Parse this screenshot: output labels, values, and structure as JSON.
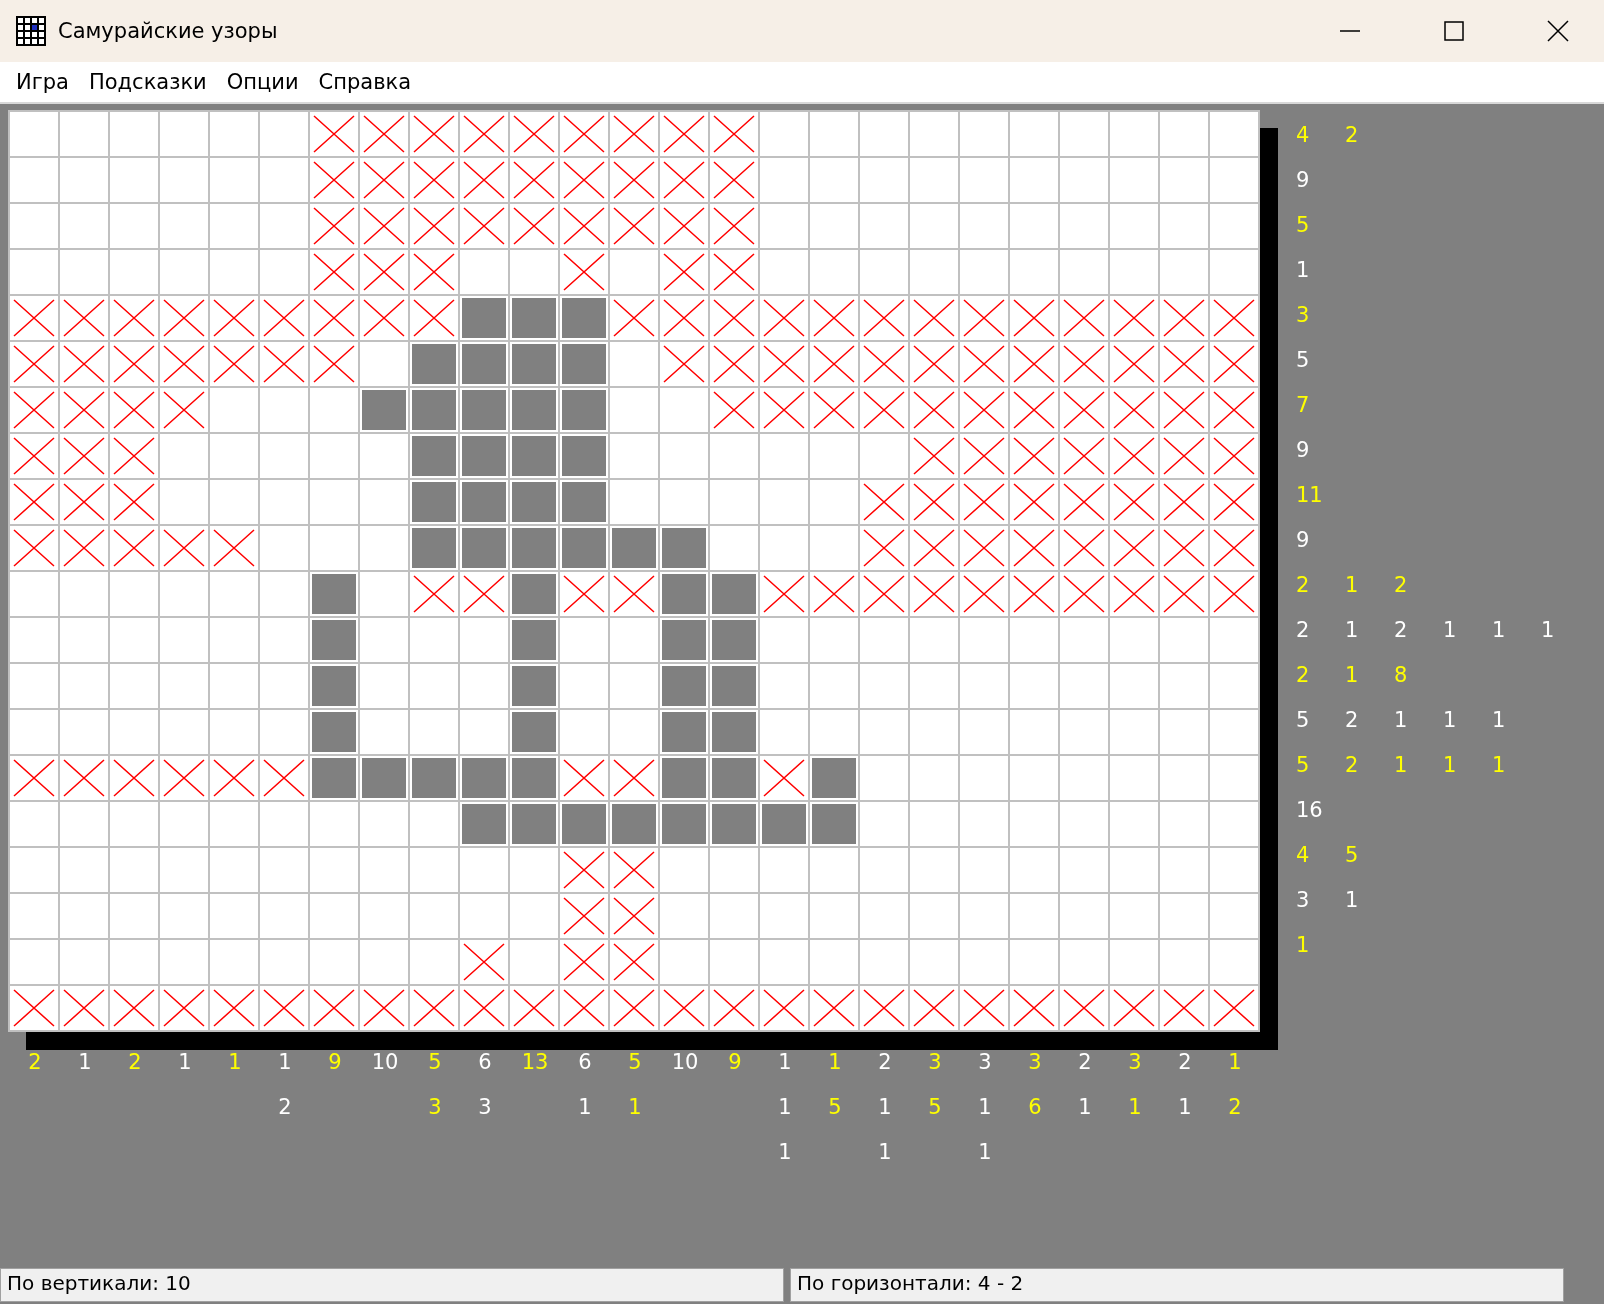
{
  "window": {
    "title": "Самурайские узоры"
  },
  "menu": [
    "Игра",
    "Подсказки",
    "Опции",
    "Справка"
  ],
  "grid": [
    {
      "filled": [
        false,
        false,
        false,
        false,
        false,
        false,
        false,
        false,
        false,
        false,
        false,
        false,
        false,
        false,
        false,
        false,
        false,
        false,
        false,
        false,
        false,
        false,
        false,
        false,
        false
      ],
      "crossed": [
        false,
        false,
        false,
        false,
        false,
        false,
        true,
        true,
        true,
        true,
        true,
        true,
        true,
        true,
        true,
        false,
        false,
        false,
        false,
        false,
        false,
        false,
        false,
        false,
        false
      ]
    },
    {
      "filled": [
        false,
        false,
        false,
        false,
        false,
        false,
        false,
        false,
        false,
        false,
        false,
        false,
        false,
        false,
        false,
        false,
        false,
        false,
        false,
        false,
        false,
        false,
        false,
        false,
        false
      ],
      "crossed": [
        false,
        false,
        false,
        false,
        false,
        false,
        true,
        true,
        true,
        true,
        true,
        true,
        true,
        true,
        true,
        false,
        false,
        false,
        false,
        false,
        false,
        false,
        false,
        false,
        false
      ]
    },
    {
      "filled": [
        false,
        false,
        false,
        false,
        false,
        false,
        false,
        false,
        false,
        false,
        false,
        false,
        false,
        false,
        false,
        false,
        false,
        false,
        false,
        false,
        false,
        false,
        false,
        false,
        false
      ],
      "crossed": [
        false,
        false,
        false,
        false,
        false,
        false,
        true,
        true,
        true,
        true,
        true,
        true,
        true,
        true,
        true,
        false,
        false,
        false,
        false,
        false,
        false,
        false,
        false,
        false,
        false
      ]
    },
    {
      "filled": [
        false,
        false,
        false,
        false,
        false,
        false,
        false,
        false,
        false,
        false,
        false,
        false,
        false,
        false,
        false,
        false,
        false,
        false,
        false,
        false,
        false,
        false,
        false,
        false,
        false
      ],
      "crossed": [
        false,
        false,
        false,
        false,
        false,
        false,
        true,
        true,
        true,
        false,
        false,
        true,
        false,
        true,
        true,
        false,
        false,
        false,
        false,
        false,
        false,
        false,
        false,
        false,
        false
      ]
    },
    {
      "filled": [
        false,
        false,
        false,
        false,
        false,
        false,
        false,
        false,
        false,
        true,
        true,
        true,
        false,
        false,
        false,
        false,
        false,
        false,
        false,
        false,
        false,
        false,
        false,
        false,
        false
      ],
      "crossed": [
        true,
        true,
        true,
        true,
        true,
        true,
        true,
        true,
        true,
        false,
        false,
        false,
        true,
        true,
        true,
        true,
        true,
        true,
        true,
        true,
        true,
        true,
        true,
        true,
        true
      ]
    },
    {
      "filled": [
        false,
        false,
        false,
        false,
        false,
        false,
        false,
        false,
        true,
        true,
        true,
        true,
        false,
        false,
        false,
        false,
        false,
        false,
        false,
        false,
        false,
        false,
        false,
        false,
        false
      ],
      "crossed": [
        true,
        true,
        true,
        true,
        true,
        true,
        true,
        false,
        false,
        false,
        false,
        false,
        false,
        true,
        true,
        true,
        true,
        true,
        true,
        true,
        true,
        true,
        true,
        true,
        true
      ]
    },
    {
      "filled": [
        false,
        false,
        false,
        false,
        false,
        false,
        false,
        true,
        true,
        true,
        true,
        true,
        false,
        false,
        false,
        false,
        false,
        false,
        false,
        false,
        false,
        false,
        false,
        false,
        false
      ],
      "crossed": [
        true,
        true,
        true,
        true,
        false,
        false,
        false,
        false,
        false,
        false,
        false,
        false,
        false,
        false,
        true,
        true,
        true,
        true,
        true,
        true,
        true,
        true,
        true,
        true,
        true
      ]
    },
    {
      "filled": [
        false,
        false,
        false,
        false,
        false,
        false,
        false,
        false,
        true,
        true,
        true,
        true,
        false,
        false,
        false,
        false,
        false,
        false,
        false,
        false,
        false,
        false,
        false,
        false,
        false
      ],
      "crossed": [
        true,
        true,
        true,
        false,
        false,
        false,
        false,
        false,
        false,
        false,
        false,
        false,
        false,
        false,
        false,
        false,
        false,
        false,
        true,
        true,
        true,
        true,
        true,
        true,
        true
      ]
    },
    {
      "filled": [
        false,
        false,
        false,
        false,
        false,
        false,
        false,
        false,
        true,
        true,
        true,
        true,
        false,
        false,
        false,
        false,
        false,
        false,
        false,
        false,
        false,
        false,
        false,
        false,
        false
      ],
      "crossed": [
        true,
        true,
        true,
        false,
        false,
        false,
        false,
        false,
        false,
        false,
        false,
        false,
        false,
        false,
        false,
        false,
        false,
        true,
        true,
        true,
        true,
        true,
        true,
        true,
        true
      ]
    },
    {
      "filled": [
        false,
        false,
        false,
        false,
        false,
        false,
        false,
        false,
        true,
        true,
        true,
        true,
        true,
        true,
        false,
        false,
        false,
        false,
        false,
        false,
        false,
        false,
        false,
        false,
        false
      ],
      "crossed": [
        true,
        true,
        true,
        true,
        true,
        false,
        false,
        false,
        false,
        false,
        false,
        false,
        false,
        false,
        false,
        false,
        false,
        true,
        true,
        true,
        true,
        true,
        true,
        true,
        true
      ]
    },
    {
      "filled": [
        false,
        false,
        false,
        false,
        false,
        false,
        true,
        false,
        false,
        false,
        true,
        false,
        false,
        true,
        true,
        false,
        false,
        false,
        false,
        false,
        false,
        false,
        false,
        false,
        false
      ],
      "crossed": [
        false,
        false,
        false,
        false,
        false,
        false,
        false,
        false,
        true,
        true,
        false,
        true,
        true,
        false,
        false,
        true,
        true,
        true,
        true,
        true,
        true,
        true,
        true,
        true,
        true
      ]
    },
    {
      "filled": [
        false,
        false,
        false,
        false,
        false,
        false,
        true,
        false,
        false,
        false,
        true,
        false,
        false,
        true,
        true,
        false,
        false,
        false,
        false,
        false,
        false,
        false,
        false,
        false,
        false
      ],
      "crossed": [
        false,
        false,
        false,
        false,
        false,
        false,
        false,
        false,
        false,
        false,
        false,
        false,
        false,
        false,
        false,
        false,
        false,
        false,
        false,
        false,
        false,
        false,
        false,
        false,
        false
      ]
    },
    {
      "filled": [
        false,
        false,
        false,
        false,
        false,
        false,
        true,
        false,
        false,
        false,
        true,
        false,
        false,
        true,
        true,
        false,
        false,
        false,
        false,
        false,
        false,
        false,
        false,
        false,
        false
      ],
      "crossed": [
        false,
        false,
        false,
        false,
        false,
        false,
        false,
        false,
        false,
        false,
        false,
        false,
        false,
        false,
        false,
        false,
        false,
        false,
        false,
        false,
        false,
        false,
        false,
        false,
        false
      ]
    },
    {
      "filled": [
        false,
        false,
        false,
        false,
        false,
        false,
        true,
        false,
        false,
        false,
        true,
        false,
        false,
        true,
        true,
        false,
        false,
        false,
        false,
        false,
        false,
        false,
        false,
        false,
        false
      ],
      "crossed": [
        false,
        false,
        false,
        false,
        false,
        false,
        false,
        false,
        false,
        false,
        false,
        false,
        false,
        false,
        false,
        false,
        false,
        false,
        false,
        false,
        false,
        false,
        false,
        false,
        false
      ]
    },
    {
      "filled": [
        false,
        false,
        false,
        false,
        false,
        false,
        true,
        true,
        true,
        true,
        true,
        false,
        false,
        true,
        true,
        false,
        true,
        false,
        false,
        false,
        false,
        false,
        false,
        false,
        false
      ],
      "crossed": [
        true,
        true,
        true,
        true,
        true,
        true,
        false,
        false,
        false,
        false,
        false,
        true,
        true,
        false,
        false,
        true,
        false,
        false,
        false,
        false,
        false,
        false,
        false,
        false,
        false
      ]
    },
    {
      "filled": [
        false,
        false,
        false,
        false,
        false,
        false,
        false,
        false,
        false,
        true,
        true,
        true,
        true,
        true,
        true,
        true,
        true,
        false,
        false,
        false,
        false,
        false,
        false,
        false,
        false
      ],
      "crossed": [
        false,
        false,
        false,
        false,
        false,
        false,
        false,
        false,
        false,
        false,
        false,
        false,
        false,
        false,
        false,
        false,
        false,
        false,
        false,
        false,
        false,
        false,
        false,
        false,
        false
      ]
    },
    {
      "filled": [
        false,
        false,
        false,
        false,
        false,
        false,
        false,
        false,
        false,
        false,
        false,
        false,
        false,
        false,
        false,
        false,
        false,
        false,
        false,
        false,
        false,
        false,
        false,
        false,
        false
      ],
      "crossed": [
        false,
        false,
        false,
        false,
        false,
        false,
        false,
        false,
        false,
        false,
        false,
        true,
        true,
        false,
        false,
        false,
        false,
        false,
        false,
        false,
        false,
        false,
        false,
        false,
        false
      ]
    },
    {
      "filled": [
        false,
        false,
        false,
        false,
        false,
        false,
        false,
        false,
        false,
        false,
        false,
        false,
        false,
        false,
        false,
        false,
        false,
        false,
        false,
        false,
        false,
        false,
        false,
        false,
        false
      ],
      "crossed": [
        false,
        false,
        false,
        false,
        false,
        false,
        false,
        false,
        false,
        false,
        false,
        true,
        true,
        false,
        false,
        false,
        false,
        false,
        false,
        false,
        false,
        false,
        false,
        false,
        false
      ]
    },
    {
      "filled": [
        false,
        false,
        false,
        false,
        false,
        false,
        false,
        false,
        false,
        false,
        false,
        false,
        false,
        false,
        false,
        false,
        false,
        false,
        false,
        false,
        false,
        false,
        false,
        false,
        false
      ],
      "crossed": [
        false,
        false,
        false,
        false,
        false,
        false,
        false,
        false,
        false,
        true,
        false,
        true,
        true,
        false,
        false,
        false,
        false,
        false,
        false,
        false,
        false,
        false,
        false,
        false,
        false
      ]
    },
    {
      "filled": [
        false,
        false,
        false,
        false,
        false,
        false,
        false,
        false,
        false,
        false,
        false,
        false,
        false,
        false,
        false,
        false,
        false,
        false,
        false,
        false,
        false,
        false,
        false,
        false,
        false
      ],
      "crossed": [
        true,
        true,
        true,
        true,
        true,
        true,
        true,
        true,
        true,
        true,
        true,
        true,
        true,
        true,
        true,
        true,
        true,
        true,
        true,
        true,
        true,
        true,
        true,
        true,
        true
      ]
    }
  ],
  "row_clues": [
    [
      "4",
      "2"
    ],
    [
      "9"
    ],
    [
      "5"
    ],
    [
      "1"
    ],
    [
      "3"
    ],
    [
      "5"
    ],
    [
      "7"
    ],
    [
      "9"
    ],
    [
      "11"
    ],
    [
      "9"
    ],
    [
      "2",
      "1",
      "2"
    ],
    [
      "2",
      "1",
      "2",
      "1",
      "1",
      "1"
    ],
    [
      "2",
      "1",
      "8"
    ],
    [
      "5",
      "2",
      "1",
      "1",
      "1"
    ],
    [
      "5",
      "2",
      "1",
      "1",
      "1"
    ],
    [
      "16"
    ],
    [
      "4",
      "5"
    ],
    [
      "3",
      "1"
    ],
    [
      "1"
    ]
  ],
  "column_clues": [
    [
      "2"
    ],
    [
      "1"
    ],
    [
      "2"
    ],
    [
      "1"
    ],
    [
      "1"
    ],
    [
      "1",
      "2"
    ],
    [
      "9"
    ],
    [
      "10"
    ],
    [
      "5",
      "3"
    ],
    [
      "6",
      "3"
    ],
    [
      "13"
    ],
    [
      "6",
      "1"
    ],
    [
      "5",
      "1"
    ],
    [
      "10"
    ],
    [
      "9"
    ],
    [
      "1",
      "1",
      "1"
    ],
    [
      "1",
      "5"
    ],
    [
      "2",
      "1",
      "1"
    ],
    [
      "3",
      "5"
    ],
    [
      "3",
      "1",
      "1"
    ],
    [
      "3",
      "6"
    ],
    [
      "2",
      "1"
    ],
    [
      "3",
      "1"
    ],
    [
      "2",
      "1"
    ],
    [
      "1",
      "2"
    ]
  ],
  "status_bar": [
    "По вертикали:  10",
    "По горизонтали:  4 - 2"
  ]
}
